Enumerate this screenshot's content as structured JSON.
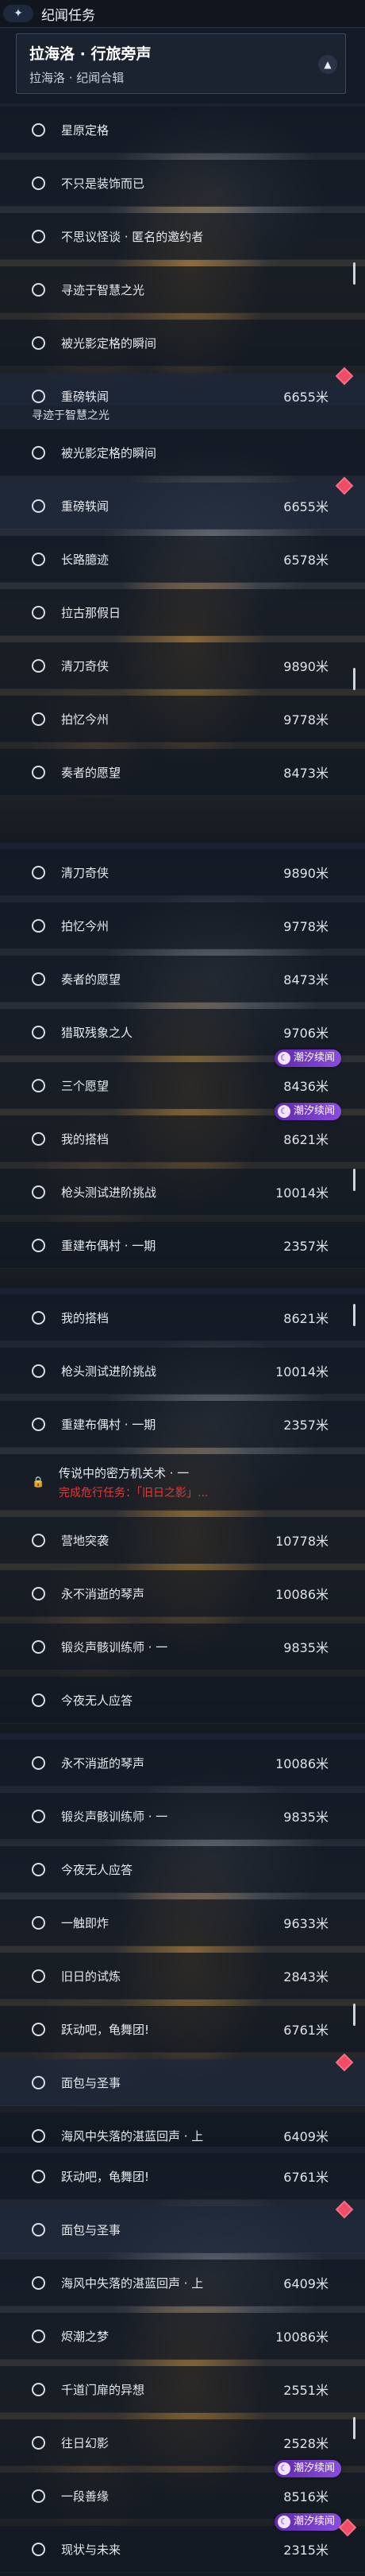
{
  "header": {
    "section_title": "纪闻任务",
    "region_title": "拉海洛 · 行旅旁声",
    "region_subtitle": "拉海洛 · 纪闻合辑"
  },
  "panels": [
    {
      "rows": [
        {
          "name": "星原定格",
          "dist": ""
        },
        {
          "name": "不只是装饰而已",
          "dist": ""
        },
        {
          "name": "不思议怪谈 · 匿名的邀约者",
          "dist": ""
        },
        {
          "name": "寻迹于智慧之光",
          "dist": ""
        },
        {
          "name": "被光影定格的瞬间",
          "dist": ""
        },
        {
          "name": "重磅轶闻",
          "dist": "6655米"
        }
      ]
    },
    {
      "cut": "寻迹于智慧之光",
      "rows": [
        {
          "name": "被光影定格的瞬间",
          "dist": ""
        },
        {
          "name": "重磅轶闻",
          "dist": "6655米"
        },
        {
          "name": "长路臆迹",
          "dist": "6578米"
        },
        {
          "name": "拉古那假日",
          "dist": ""
        },
        {
          "name": "清刀奇侠",
          "dist": "9890米"
        },
        {
          "name": "拍忆今州",
          "dist": "9778米"
        },
        {
          "name": "奏者的愿望",
          "dist": "8473米"
        }
      ]
    },
    {
      "rows": [
        {
          "name": "清刀奇侠",
          "dist": "9890米"
        },
        {
          "name": "拍忆今州",
          "dist": "9778米"
        },
        {
          "name": "奏者的愿望",
          "dist": "8473米"
        },
        {
          "name": "猎取残象之人",
          "dist": "9706米"
        },
        {
          "name": "三个愿望",
          "dist": "8436米",
          "badge": "潮汐续闻"
        },
        {
          "name": "我的搭档",
          "dist": "8621米",
          "badge": "潮汐续闻"
        },
        {
          "name": "枪头测试进阶挑战",
          "dist": "10014米"
        },
        {
          "name": "重建布偶村 · 一期",
          "dist": "2357米"
        }
      ]
    },
    {
      "rows": [
        {
          "name": "我的搭档",
          "dist": "8621米"
        },
        {
          "name": "枪头测试进阶挑战",
          "dist": "10014米"
        },
        {
          "name": "重建布偶村 · 一期",
          "dist": "2357米"
        }
      ],
      "locked": {
        "title": "传说中的密方机关术 · 一",
        "requirement": "完成危行任务：「旧日之影」..."
      },
      "rows2": [
        {
          "name": "营地突袭",
          "dist": "10778米"
        },
        {
          "name": "永不消逝的琴声",
          "dist": "10086米"
        },
        {
          "name": "锻炎声骸训练师 · 一",
          "dist": "9835米"
        },
        {
          "name": "今夜无人应答",
          "dist": ""
        }
      ]
    },
    {
      "rows": [
        {
          "name": "永不消逝的琴声",
          "dist": "10086米"
        },
        {
          "name": "锻炎声骸训练师 · 一",
          "dist": "9835米"
        },
        {
          "name": "今夜无人应答",
          "dist": ""
        },
        {
          "name": "一触即炸",
          "dist": "9633米"
        },
        {
          "name": "旧日的试炼",
          "dist": "2843米"
        },
        {
          "name": "跃动吧，龟舞团!",
          "dist": "6761米"
        },
        {
          "name": "面包与圣事",
          "dist": ""
        },
        {
          "name": "海风中失落的湛蓝回声 · 上",
          "dist": "6409米"
        }
      ]
    },
    {
      "rows": [
        {
          "name": "跃动吧，龟舞团!",
          "dist": "6761米"
        },
        {
          "name": "面包与圣事",
          "dist": ""
        },
        {
          "name": "海风中失落的湛蓝回声 · 上",
          "dist": "6409米"
        },
        {
          "name": "烬潮之梦",
          "dist": "10086米"
        },
        {
          "name": "千道门扉的异想",
          "dist": "2551米"
        },
        {
          "name": "往日幻影",
          "dist": "2528米"
        },
        {
          "name": "一段善缘",
          "dist": "8516米",
          "badge": "潮汐续闻"
        },
        {
          "name": "现状与未来",
          "dist": "2315米",
          "badge": "潮汐续闻"
        }
      ]
    }
  ]
}
